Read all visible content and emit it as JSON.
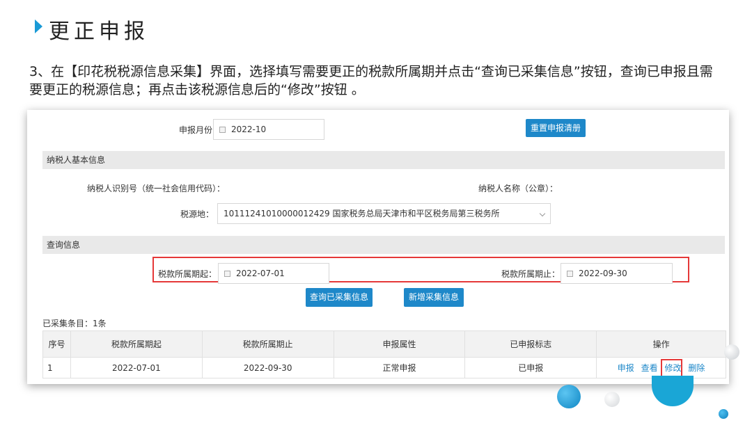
{
  "slide": {
    "title": "更正申报",
    "description": "3、在【印花税税源信息采集】界面，选择填写需要更正的税款所属期并点击“查询已采集信息”按钮，查询已申报且需要更正的税源信息；再点击该税源信息后的“修改”按钮 。"
  },
  "form": {
    "declare_month_label": "申报月份：",
    "declare_month_value": "2022-10",
    "reset_button": "重置申报清册"
  },
  "taxpayer_section": {
    "title": "纳税人基本信息",
    "id_label": "纳税人识别号（统一社会信用代码）：",
    "name_label": "纳税人名称（公章）：",
    "tax_source_label": "税源地：",
    "tax_source_value": "10111241010000012429 国家税务总局天津市和平区税务局第三税务所"
  },
  "query_section": {
    "title": "查询信息",
    "period_start_label": "税款所属期起：",
    "period_start_value": "2022-07-01",
    "period_end_label": "税款所属期止：",
    "period_end_value": "2022-09-30",
    "query_button": "查询已采集信息",
    "add_button": "新增采集信息"
  },
  "results": {
    "count_label": "已采集条目：1条",
    "columns": [
      "序号",
      "税款所属期起",
      "税款所属期止",
      "申报属性",
      "已申报标志",
      "操作"
    ],
    "rows": [
      {
        "index": "1",
        "start": "2022-07-01",
        "end": "2022-09-30",
        "attribute": "正常申报",
        "status": "已申报",
        "actions": {
          "declare": "申报",
          "view": "查看",
          "edit": "修改",
          "delete": "删除"
        }
      }
    ]
  },
  "colors": {
    "accent_blue": "#1e88c9",
    "highlight_red": "#e53838",
    "status_green": "#2eaa2e"
  }
}
